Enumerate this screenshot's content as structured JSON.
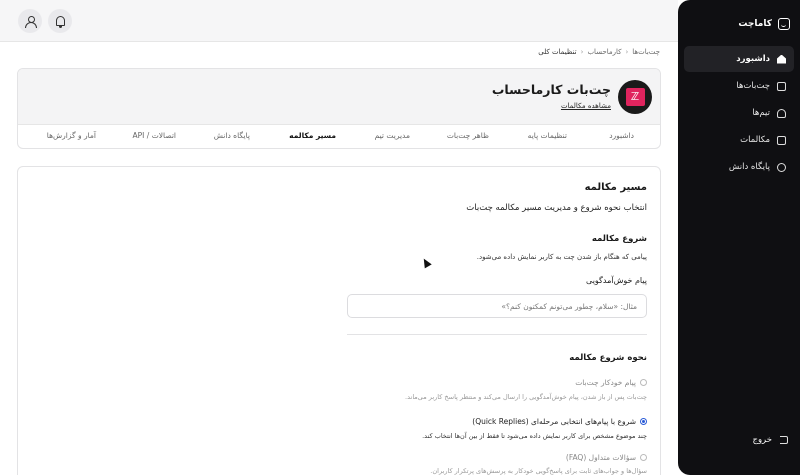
{
  "brand": {
    "name": "کاماچت"
  },
  "sidebar": {
    "items": [
      {
        "label": "داشبورد",
        "icon": "home-icon",
        "active": true
      },
      {
        "label": "چت‌بات‌ها",
        "icon": "bot-icon",
        "active": false
      },
      {
        "label": "تیم‌ها",
        "icon": "team-icon",
        "active": false
      },
      {
        "label": "مکالمات",
        "icon": "chat-icon",
        "active": false
      },
      {
        "label": "پایگاه دانش",
        "icon": "knowledge-base-icon",
        "active": false
      }
    ],
    "logout": "خروج"
  },
  "breadcrumb": {
    "items": [
      "چت‌بات‌ها",
      "کارماحساب",
      "تنظیمات کلی"
    ]
  },
  "bot": {
    "name": "چت‌بات کارماحساب",
    "view_conversations": "مشاهده مکالمات",
    "avatar_glyph": "ℤ"
  },
  "tabs": [
    {
      "label": "داشبورد",
      "active": false
    },
    {
      "label": "تنظیمات پایه",
      "active": false
    },
    {
      "label": "ظاهر چت‌بات",
      "active": false
    },
    {
      "label": "مدیریت تیم",
      "active": false
    },
    {
      "label": "مسیر مکالمه",
      "active": true
    },
    {
      "label": "پایگاه دانش",
      "active": false
    },
    {
      "label": "اتصالات / API",
      "active": false
    },
    {
      "label": "آمار و گزارش‌ها",
      "active": false
    }
  ],
  "conversation_flow": {
    "title": "مسیر مکالمه",
    "subtitle": "انتخاب نحوه شروع و مدیریت مسیر مکالمه چت‌بات",
    "start": {
      "title": "شروع مکالمه",
      "description": "پیامی که هنگام باز شدن چت به کاربر نمایش داده می‌شود."
    },
    "welcome": {
      "label": "پیام خوش‌آمدگویی",
      "placeholder": "مثال: «سلام، چطور می‌تونم کمکتون کنم؟»",
      "value": ""
    },
    "start_mode": {
      "title": "نحوه شروع مکالمه",
      "options": [
        {
          "label": "پیام خودکار چت‌بات",
          "description": "چت‌بات پس از باز شدن، پیام خوش‌آمدگویی را ارسال می‌کند و منتظر پاسخ کاربر می‌ماند.",
          "selected": false
        },
        {
          "label": "شروع با پیام‌های انتخابی مرحله‌ای (Quick Replies)",
          "description": "چند موضوع مشخص برای کاربر نمایش داده می‌شود تا فقط از بین آن‌ها انتخاب کند.",
          "selected": true
        },
        {
          "label": "سؤالات متداول (FAQ)",
          "description": "سؤال‌ها و جواب‌های ثابت برای پاسخ‌گویی خودکار به پرسش‌های پرتکرار کاربران.",
          "selected": false
        }
      ]
    }
  },
  "colors": {
    "accent": "#2a5bd7",
    "sidebar_bg": "#0f0f12",
    "avatar_accent": "#e0245e"
  }
}
